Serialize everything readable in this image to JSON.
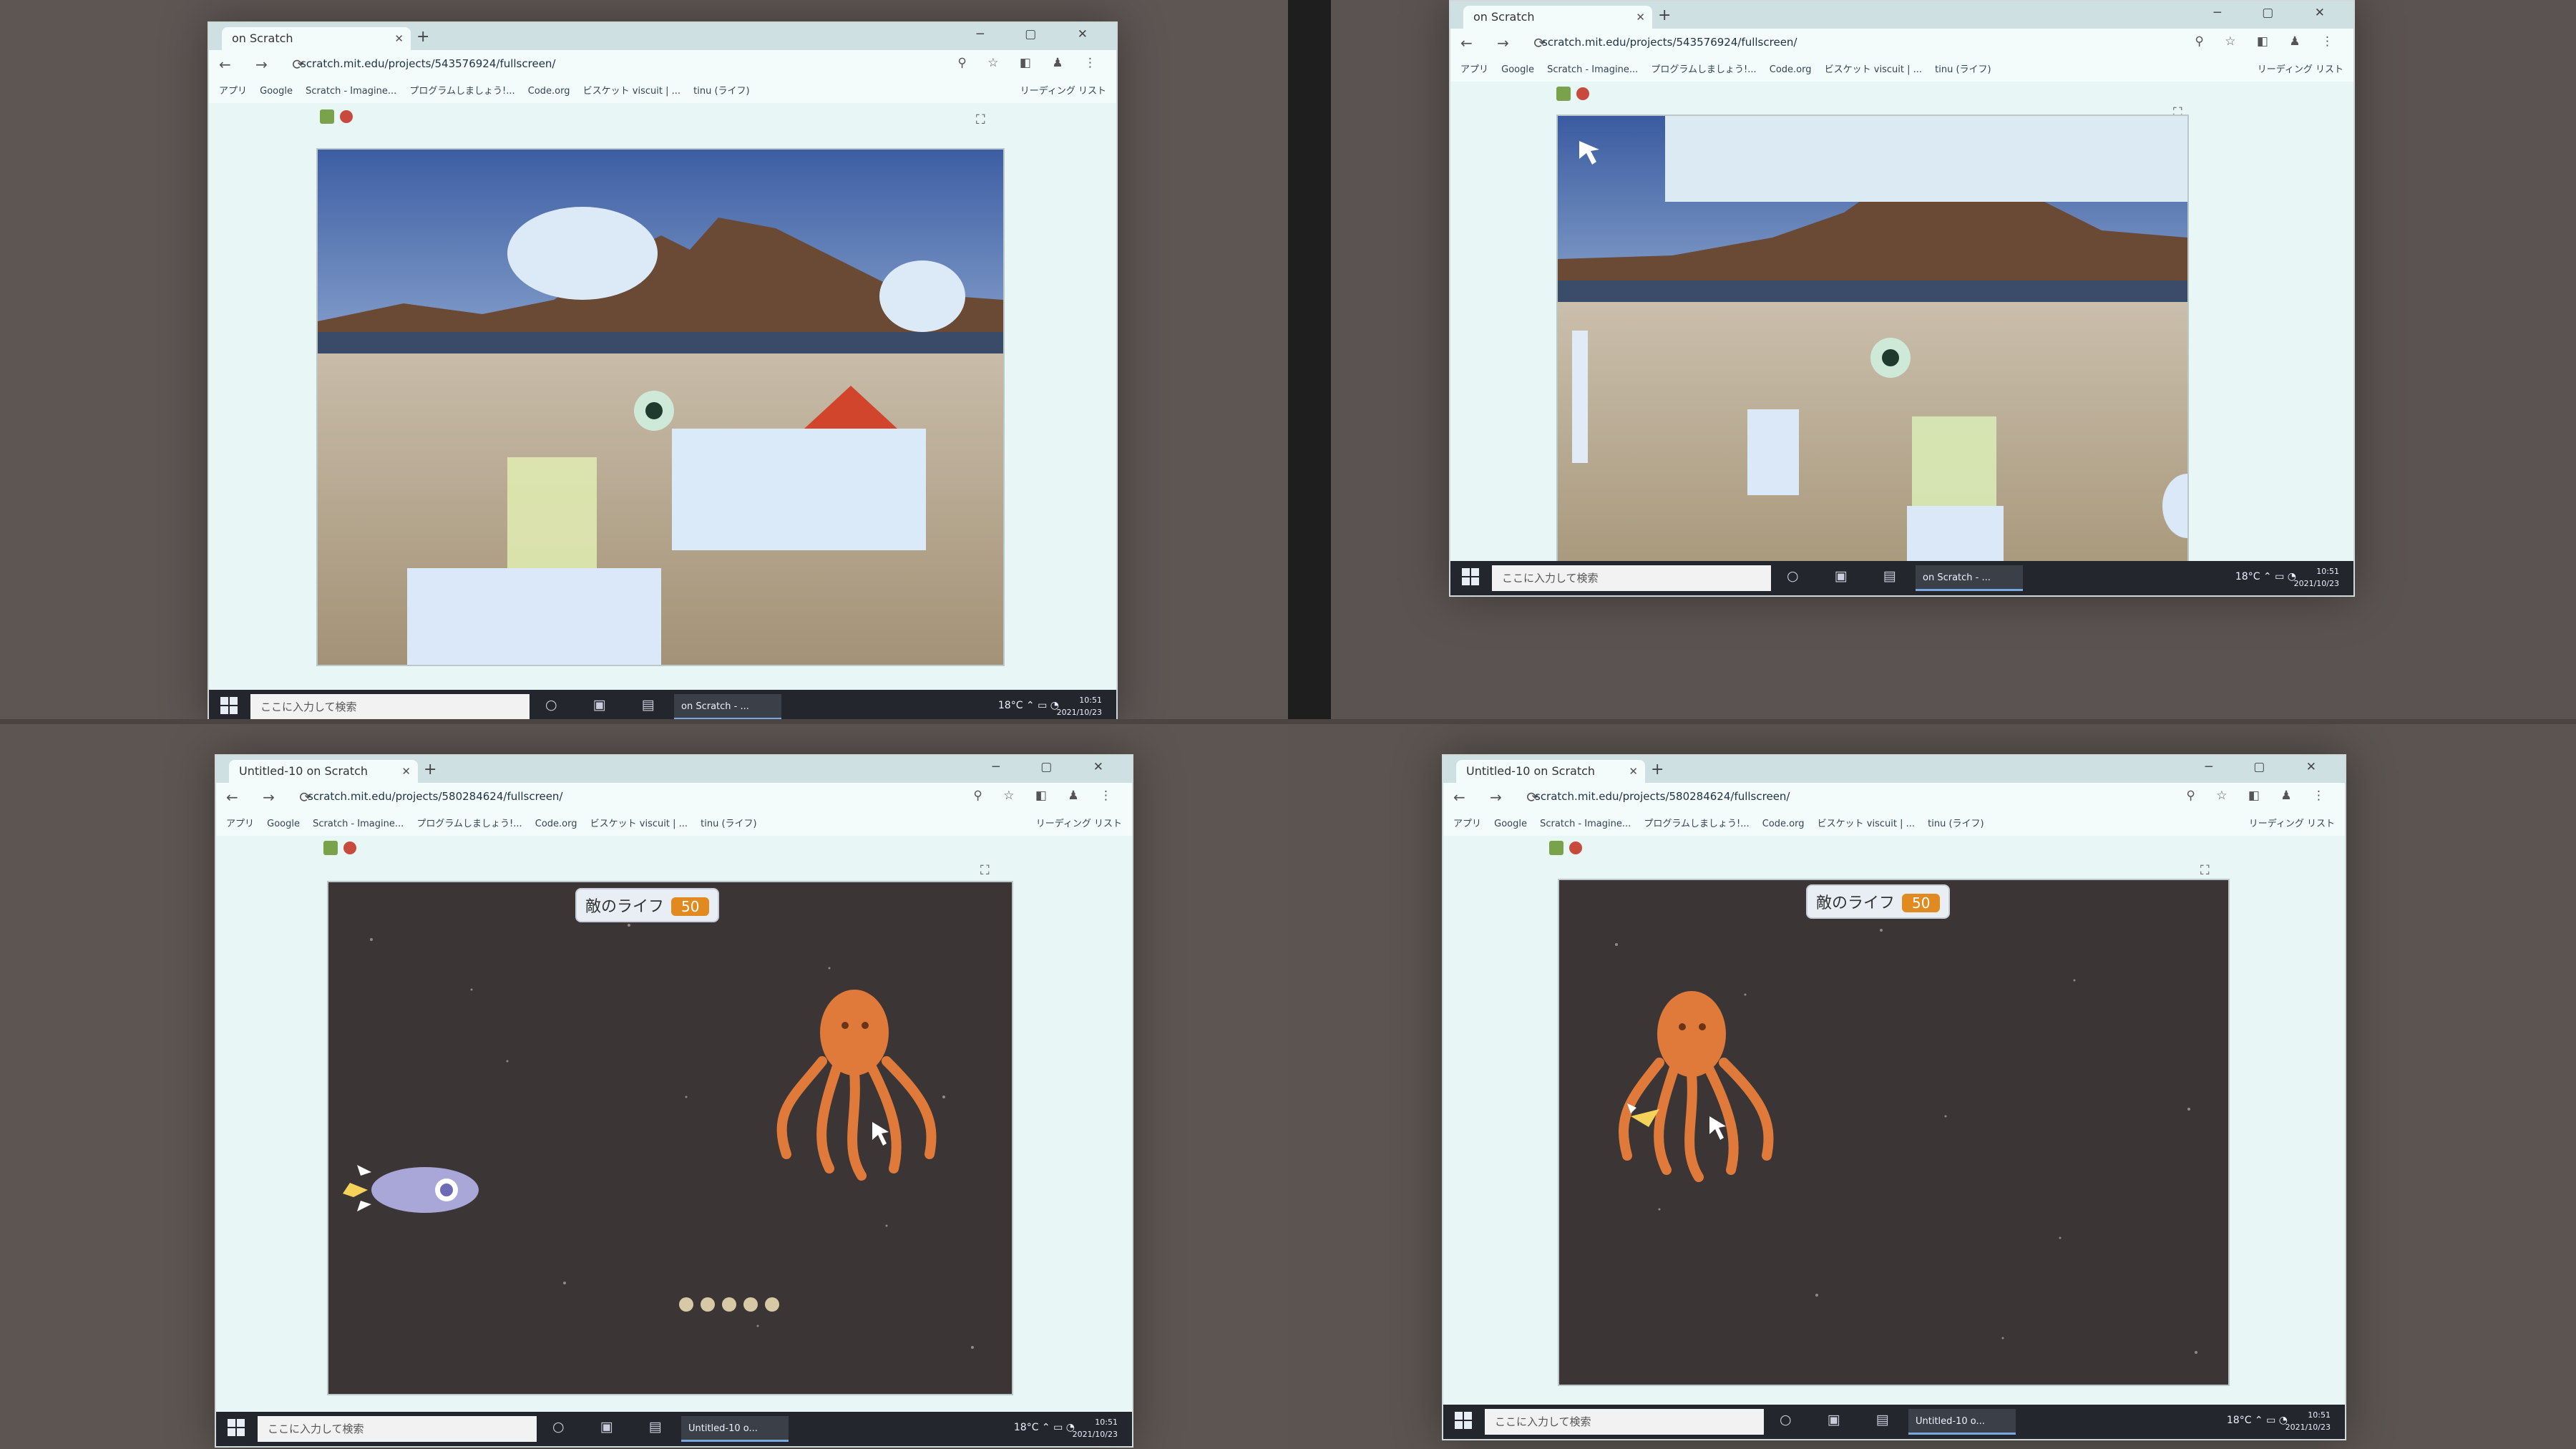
{
  "panels": [
    {
      "id": "top-left",
      "tab_title": "on Scratch",
      "url": "scratch.mit.edu/projects/543576924/fullscreen/"
    },
    {
      "id": "top-right",
      "tab_title": "on Scratch",
      "url": "scratch.mit.edu/projects/543576924/fullscreen/"
    },
    {
      "id": "bottom-left",
      "tab_title": "Untitled-10 on Scratch",
      "url": "scratch.mit.edu/projects/580284624/fullscreen/",
      "life_label": "敵のライフ",
      "life_value": "50"
    },
    {
      "id": "bottom-right",
      "tab_title": "Untitled-10 on Scratch",
      "url": "scratch.mit.edu/projects/580284624/fullscreen/",
      "life_label": "敵のライフ",
      "life_value": "50"
    }
  ],
  "bookmarks": [
    "アプリ",
    "Google",
    "Scratch - Imagine...",
    "プログラムしましょう!...",
    "Code.org",
    "ビスケット viscuit | ...",
    "tinu (ライフ)"
  ],
  "reading_list": "リーディング リスト",
  "taskbar": {
    "search_placeholder": "ここに入力して検索",
    "apps": [
      "on Scratch - ...",
      "on Scratch - ...",
      "Untitled-10 o...",
      "Untitled-10 o..."
    ],
    "weather": "18°C",
    "time": "10:51",
    "date": "2021/10/23"
  },
  "colors": {
    "scratch_flag": "#7aa24a",
    "stop": "#c84a3d",
    "life_badge": "#e08a20",
    "octopus": "#e07a3a"
  }
}
